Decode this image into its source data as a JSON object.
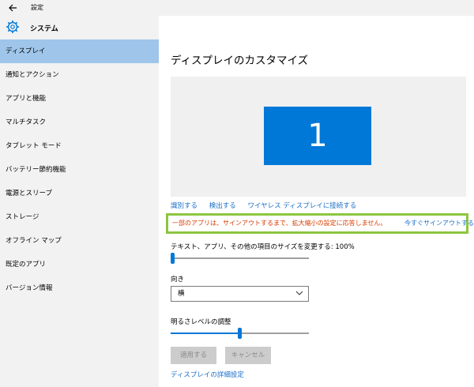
{
  "window": {
    "title": "設定"
  },
  "sidebar": {
    "header": "システム",
    "items": [
      {
        "label": "ディスプレイ"
      },
      {
        "label": "通知とアクション"
      },
      {
        "label": "アプリと機能"
      },
      {
        "label": "マルチタスク"
      },
      {
        "label": "タブレット モード"
      },
      {
        "label": "バッテリー節約機能"
      },
      {
        "label": "電源とスリープ"
      },
      {
        "label": "ストレージ"
      },
      {
        "label": "オフライン マップ"
      },
      {
        "label": "既定のアプリ"
      },
      {
        "label": "バージョン情報"
      }
    ],
    "active_index": 0
  },
  "main": {
    "title": "ディスプレイのカスタマイズ",
    "monitor_number": "1",
    "links": {
      "identify": "識別する",
      "detect": "検出する",
      "wireless": "ワイヤレス ディスプレイに接続する"
    },
    "warning": {
      "message": "一部のアプリは、サインアウトするまで、拡大縮小の設定に応答しません。",
      "signin_link": "今すぐサインアウトする"
    },
    "scale": {
      "label": "テキスト、アプリ、その他の項目のサイズを変更する: 100%",
      "value_fraction": 0.0
    },
    "orientation": {
      "label": "向き",
      "selected": "横"
    },
    "brightness": {
      "label": "明るさレベルの調整",
      "value_fraction": 0.5
    },
    "buttons": {
      "apply": "適用する",
      "cancel": "キャンセル"
    },
    "advanced_link": "ディスプレイの詳細設定"
  },
  "colors": {
    "accent": "#0078d7",
    "highlight_border": "#8dc63f",
    "warning_text": "#d83b01",
    "link": "#1a6fc9",
    "active_nav": "#9fc6ea"
  },
  "icons": {
    "back": "back-arrow-icon",
    "system": "gear-icon",
    "dropdown": "chevron-down-icon"
  }
}
